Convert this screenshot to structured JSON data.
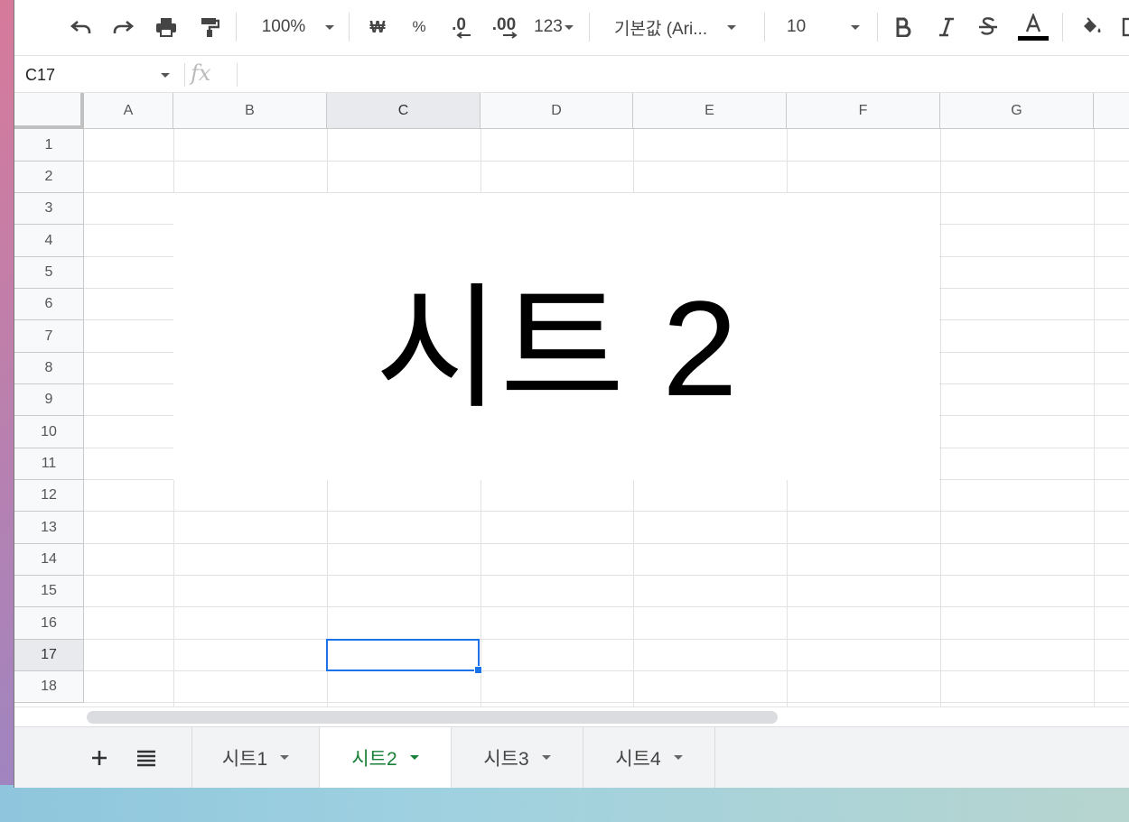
{
  "toolbar": {
    "zoom": "100%",
    "currency_label": "₩",
    "percent_label": "%",
    "decimal_decrease_label": ".0",
    "decimal_increase_label": ".00",
    "number_format_label": "123",
    "font_name": "기본값 (Ari...",
    "font_size": "10",
    "text_color": "#000000"
  },
  "formula_bar": {
    "cell_reference": "C17",
    "fx_label": "fx",
    "value": ""
  },
  "grid": {
    "columns": [
      "A",
      "B",
      "C",
      "D",
      "E",
      "F",
      "G"
    ],
    "rows": [
      "1",
      "2",
      "3",
      "4",
      "5",
      "6",
      "7",
      "8",
      "9",
      "10",
      "11",
      "12",
      "13",
      "14",
      "15",
      "16",
      "17",
      "18"
    ],
    "selected_column": "C",
    "selected_row": "17",
    "merged_cell_text": "시트 2",
    "selection_color": "#1a73e8"
  },
  "sheet_tabs": {
    "tabs": [
      {
        "label": "시트1"
      },
      {
        "label": "시트2"
      },
      {
        "label": "시트3"
      },
      {
        "label": "시트4"
      }
    ],
    "active_index": 1,
    "active_color": "#188038"
  }
}
